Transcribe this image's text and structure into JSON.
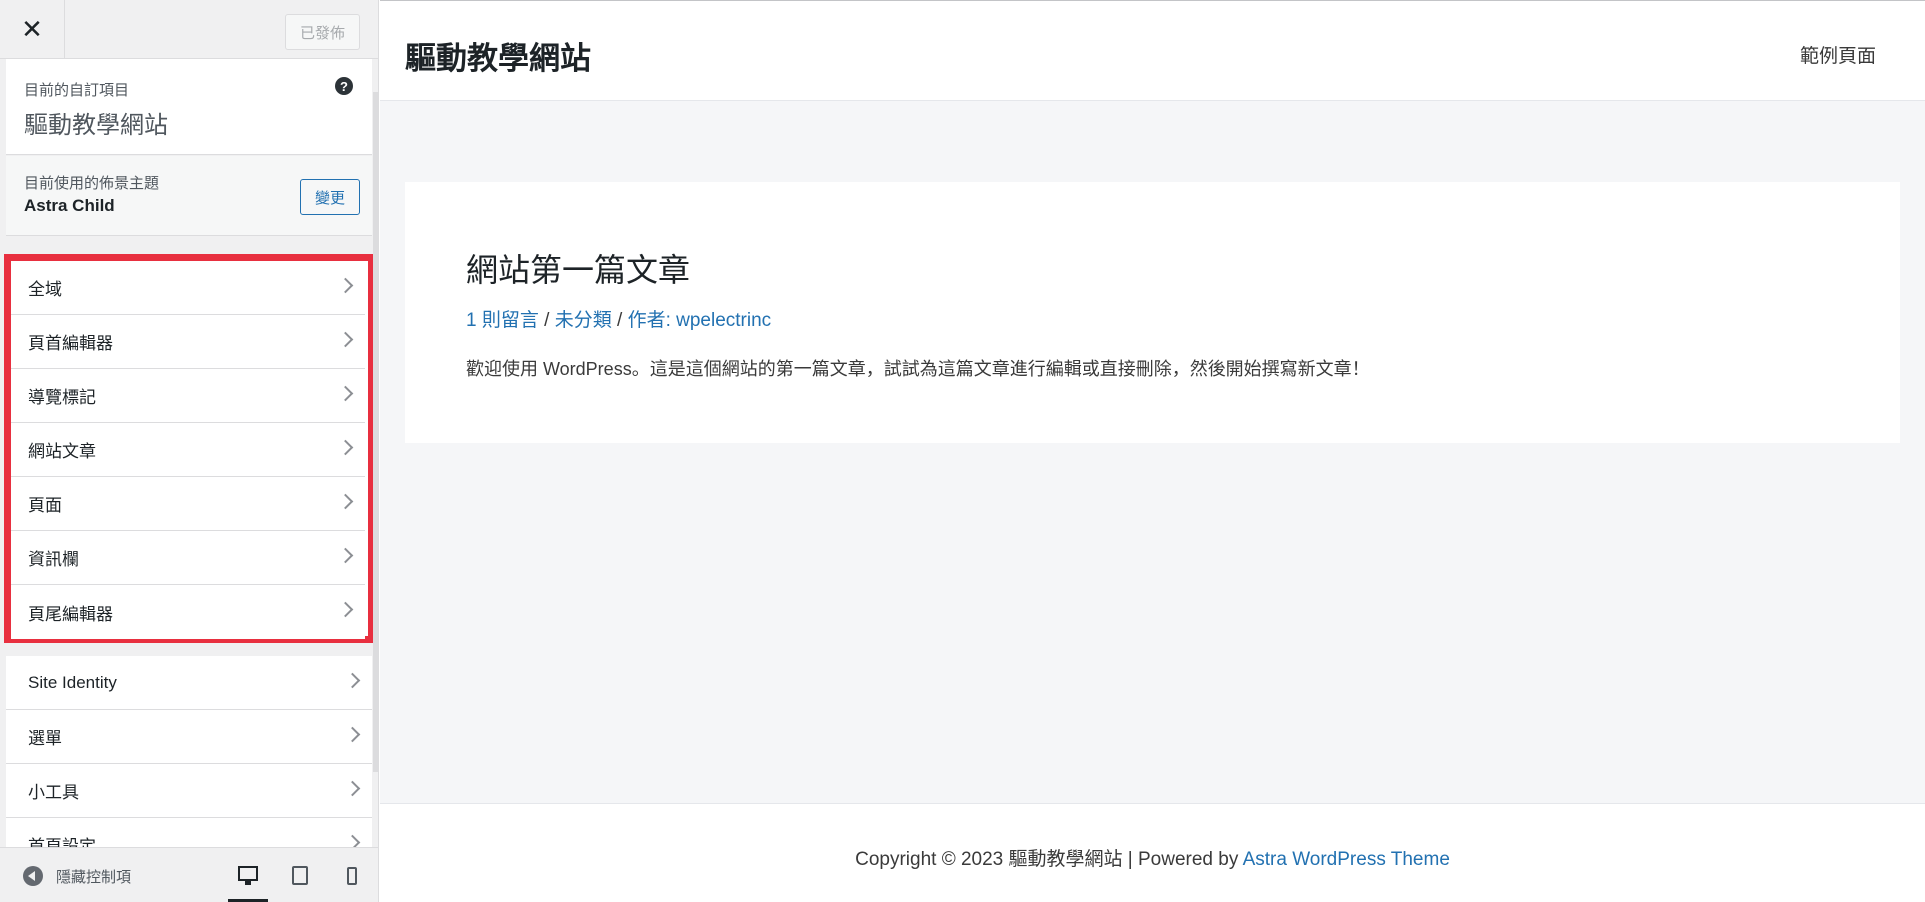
{
  "sidebar": {
    "close_glyph": "✕",
    "publish_label": "已發佈",
    "customizing_label": "目前的自訂項目",
    "site_name": "驅動教學網站",
    "help_glyph": "?",
    "theme_label": "目前使用的佈景主題",
    "theme_name": "Astra Child",
    "change_label": "變更",
    "highlighted_items": [
      {
        "label": "全域"
      },
      {
        "label": "頁首編輯器"
      },
      {
        "label": "導覽標記"
      },
      {
        "label": "網站文章"
      },
      {
        "label": "頁面"
      },
      {
        "label": "資訊欄"
      },
      {
        "label": "頁尾編輯器"
      }
    ],
    "items": [
      {
        "label": "Site Identity"
      },
      {
        "label": "選單"
      },
      {
        "label": "小工具"
      },
      {
        "label": "首頁設定"
      }
    ],
    "hide_controls_label": "隱藏控制項",
    "highlight_color": "#e82f3f"
  },
  "preview": {
    "site_title": "驅動教學網站",
    "nav_link": "範例頁面",
    "post": {
      "title": "網站第一篇文章",
      "comments": "1 則留言",
      "category": "未分類",
      "author": "作者: wpelectrinc",
      "body": "歡迎使用 WordPress。這是這個網站的第一篇文章，試試為這篇文章進行編輯或直接刪除，然後開始撰寫新文章！"
    },
    "footer": {
      "copyright": "Copyright © 2023 驅動教學網站 | Powered by ",
      "theme_link": "Astra WordPress Theme"
    }
  }
}
